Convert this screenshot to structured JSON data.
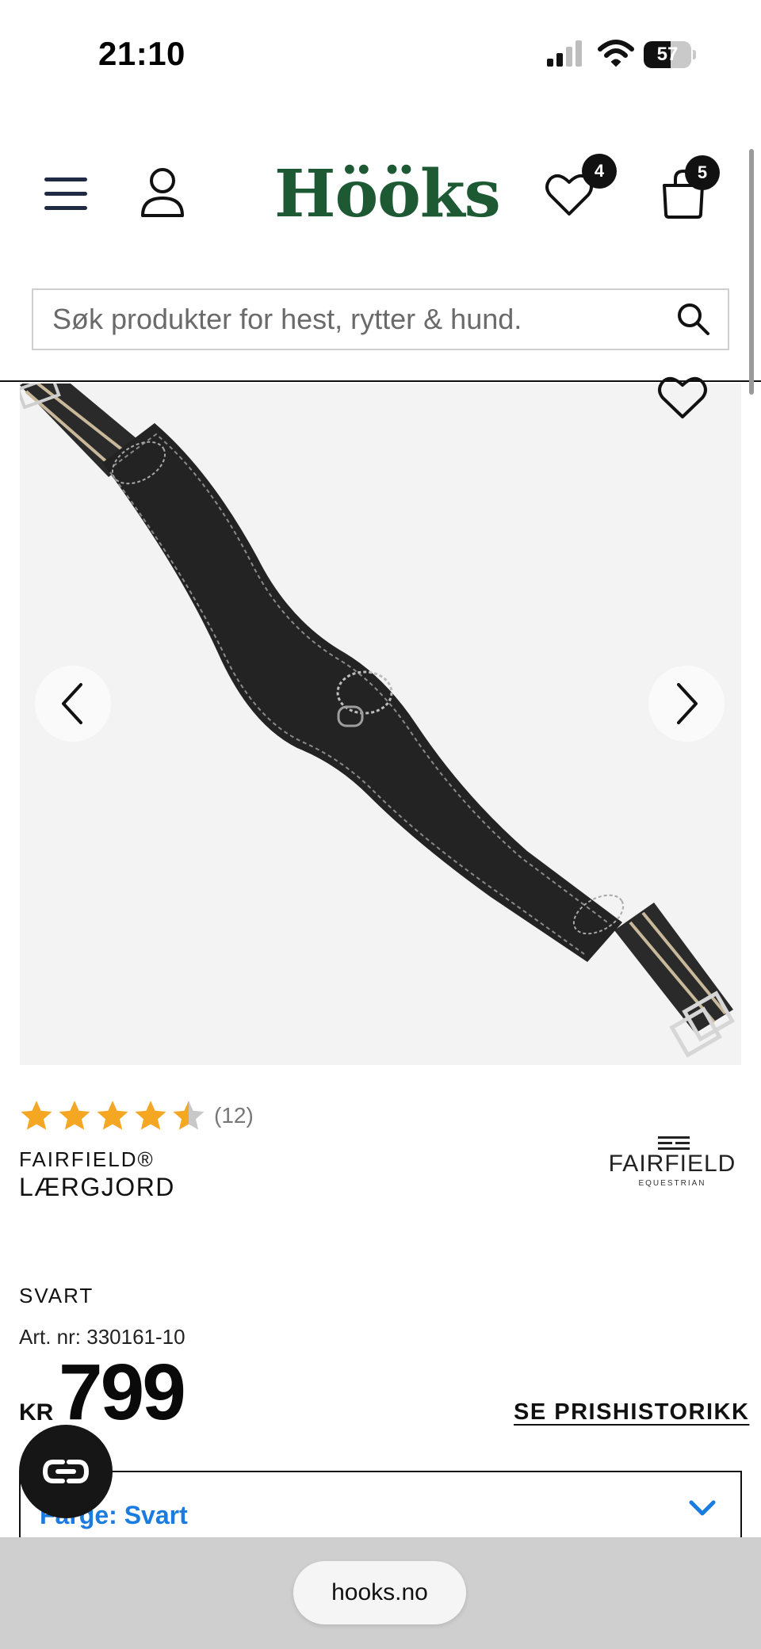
{
  "status_bar": {
    "time": "21:10",
    "battery_level": "57",
    "battery_fraction": 0.57
  },
  "header": {
    "logo": "Hööks",
    "wishlist_count": "4",
    "cart_count": "5",
    "search_placeholder": "Søk produkter for hest, rytter & hund."
  },
  "product": {
    "rating_value": 4.5,
    "rating_count": "(12)",
    "brand": "FAIRFIELD®",
    "title": "LÆRGJORD",
    "brand_logo": {
      "word": "FAIRFIELD",
      "sub": "EQUESTRIAN"
    },
    "color": "SVART",
    "art_nr": "Art. nr: 330161-10",
    "currency": "KR",
    "price": "799",
    "price_history_link": "SE PRISHISTORIKK",
    "variant_select_label": "Farge: Svart"
  },
  "browser": {
    "url": "hooks.no"
  },
  "colors": {
    "logo_green": "#1d5a34",
    "badge": "#111111",
    "star": "#f5a623",
    "link_blue": "#1a7be0",
    "nav_icon": "#1f2a44"
  },
  "icons": [
    "menu-icon",
    "user-icon",
    "heart-icon",
    "cart-icon",
    "search-icon",
    "chevron-left-icon",
    "chevron-right-icon",
    "chevron-down-icon",
    "chat-icon",
    "star-icon",
    "wifi-icon",
    "signal-icon",
    "battery-icon"
  ]
}
